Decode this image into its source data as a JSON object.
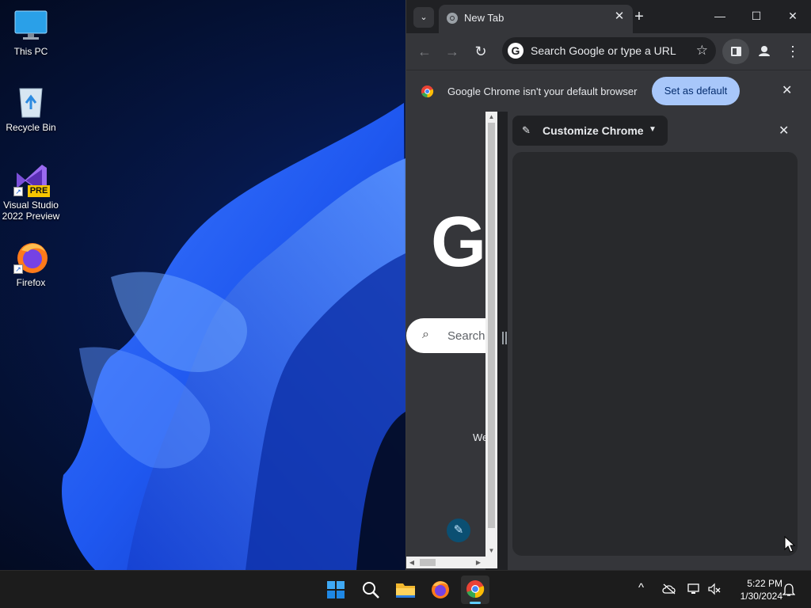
{
  "desktop": {
    "icons": [
      {
        "label": "This PC",
        "icon": "monitor-icon"
      },
      {
        "label": "Recycle Bin",
        "icon": "recycle-bin-icon"
      },
      {
        "label_line1": "Visual Studio",
        "label_line2": "2022 Preview",
        "badge": "PRE",
        "icon": "visual-studio-icon"
      },
      {
        "label": "Firefox",
        "icon": "firefox-icon"
      }
    ],
    "shortcut_arrow": "↗"
  },
  "chrome": {
    "tab_search": "⌄",
    "tab": {
      "title": "New Tab",
      "close": "✕"
    },
    "new_tab": "+",
    "window": {
      "minimize": "—",
      "maximize": "☐",
      "close": "✕"
    },
    "toolbar": {
      "back": "←",
      "forward": "→",
      "reload": "↻",
      "omnibox_placeholder": "Search Google or type a URL",
      "omnibox_g": "G",
      "bookmark_star": "☆",
      "menu": "⋮"
    },
    "infobar": {
      "message": "Google Chrome isn't your default browser",
      "button": "Set as default",
      "close": "✕"
    },
    "ntp": {
      "logo_letter": "G",
      "search_placeholder": "Search",
      "search_icon": "⌕",
      "partial_text": "We",
      "customize_icon": "✎"
    },
    "side_panel": {
      "title": "Customize Chrome",
      "pencil": "✎",
      "caret": "▼",
      "close": "✕"
    }
  },
  "taskbar": {
    "clock_time": "5:22 PM",
    "clock_date": "1/30/2024",
    "tray_chevron": "^",
    "apps": [
      "start-icon",
      "search-icon",
      "file-explorer-icon",
      "firefox-icon",
      "chrome-icon"
    ],
    "active_app": "chrome-icon",
    "colors": {
      "accent": "#60cdff",
      "background": "#1c1c1c"
    }
  }
}
